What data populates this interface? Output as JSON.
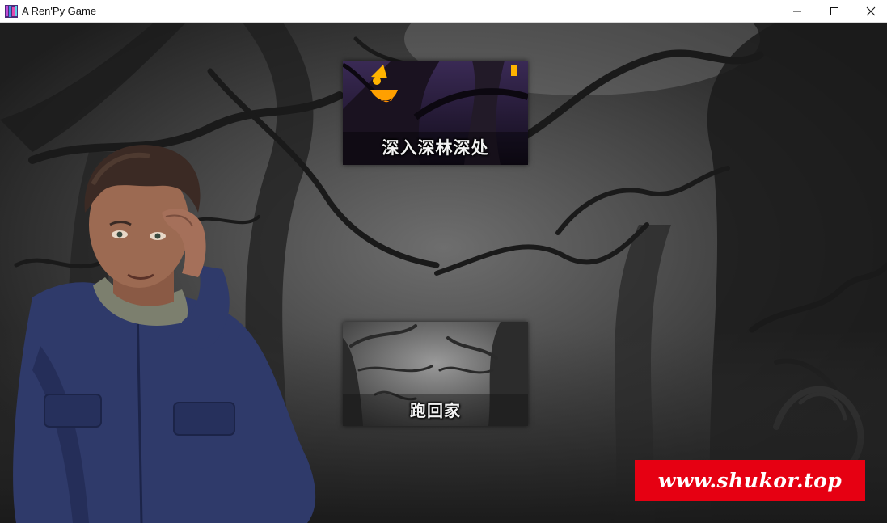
{
  "window": {
    "title": "A Ren'Py Game",
    "controls": [
      "minimize",
      "maximize",
      "close"
    ]
  },
  "choices": [
    {
      "label": "深入深林深处"
    },
    {
      "label": "跑回家"
    }
  ],
  "watermark": {
    "text": "www.shukor.top",
    "color": "#e60012"
  },
  "icons": {
    "app": "renpy-app-icon",
    "minimize": "minimize-icon",
    "maximize": "maximize-icon",
    "close": "close-icon"
  }
}
